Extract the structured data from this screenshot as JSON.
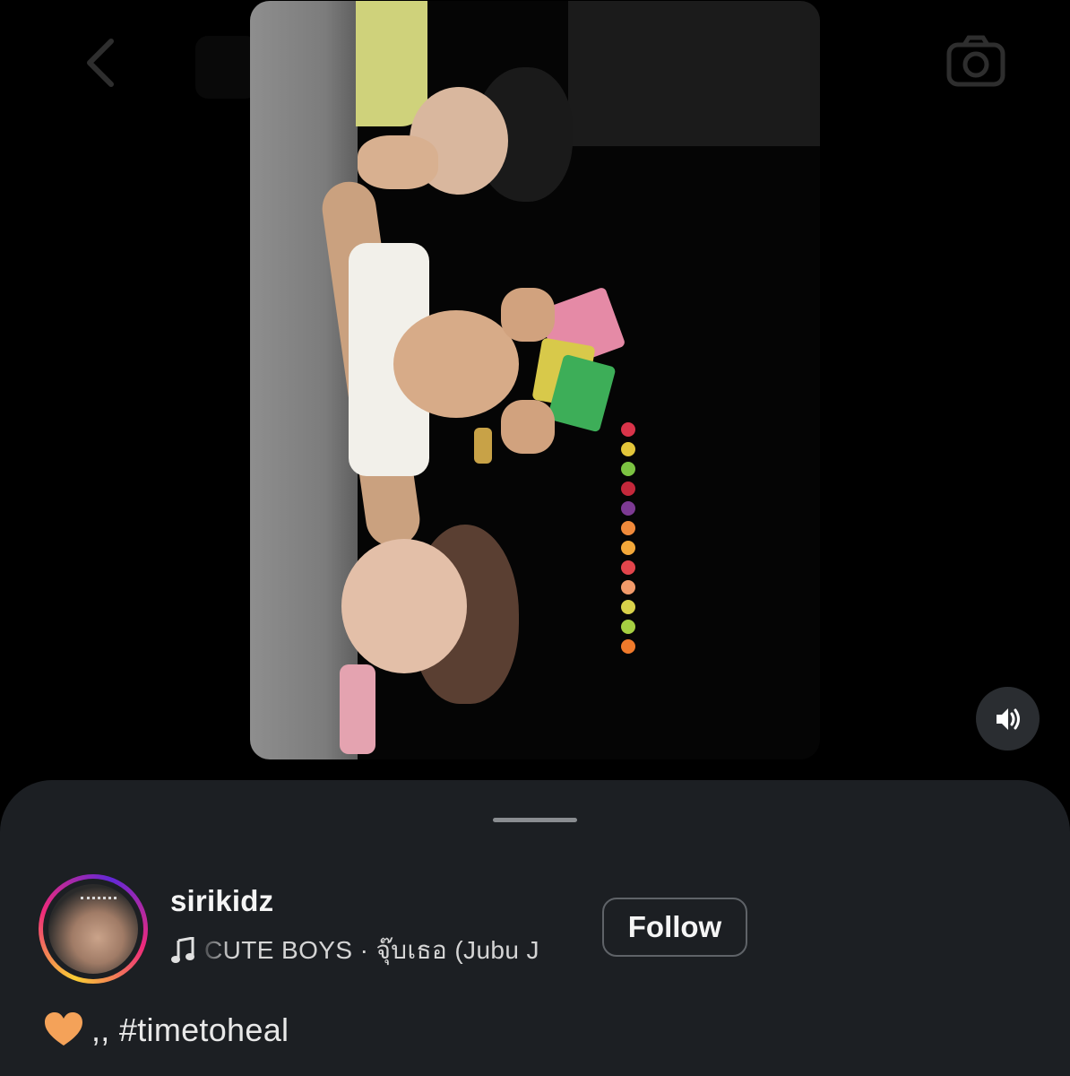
{
  "post": {
    "username": "sirikidz",
    "music_icon": "music-note-icon",
    "music_text": "CUTE BOYS · จุ๊บเธอ (Jubu J",
    "follow_label": "Follow",
    "caption_emoji": "orange-heart-icon",
    "caption_text": ",, #timetoheal"
  },
  "colors": {
    "background": "#000000",
    "sheet": "#1c1f23",
    "text_primary": "#f5f5f5",
    "text_secondary": "#d5d5d5",
    "button_border": "#5f6368",
    "heart": "#f4a259"
  },
  "icons": {
    "back": "back-chevron-icon",
    "camera": "camera-icon",
    "volume": "speaker-volume-icon"
  }
}
